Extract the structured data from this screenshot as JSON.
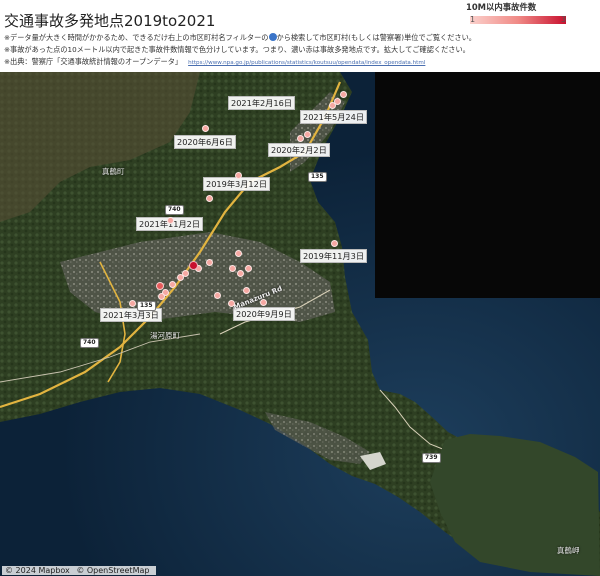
{
  "header": {
    "title": "交通事故多発地点2019to2021",
    "note1_a": "※データ量が大きく時間がかかるため、できるだけ右上の市区町村名フィルターの",
    "note1_b": "から検索して市区町村(もしくは警察署)単位でご覧ください。",
    "note2": "※事故があった点の10メートル以内で起きた事故件数情報で色分けしています。つまり、濃い赤は事故多発地点です。拡大してご確認ください。",
    "note3": "※出典：警察庁「交通事故統計情報のオープンデータ」",
    "source_url": "https://www.npa.go.jp/publications/statistics/koutsuu/opendata/index_opendata.html"
  },
  "legend": {
    "title": "10M以内事故件数",
    "min": "1",
    "max": "3",
    "color_min": "#fbd1cc",
    "color_max": "#c8102e"
  },
  "map": {
    "date_labels": [
      "2021年2月16日",
      "2021年5月24日",
      "2020年6月6日",
      "2020年2月2日",
      "2019年3月12日",
      "2021年11月2日",
      "2019年11月3日",
      "2021年3月3日",
      "2020年9月9日"
    ],
    "road_shields": [
      "135",
      "740",
      "135",
      "740",
      "739"
    ],
    "road_name": "Manazuru Rd",
    "place_labels": [
      "真鶴町",
      "湯河原町",
      "真鶴岬"
    ],
    "attribution": [
      "© 2024 Mapbox",
      "© OpenStreetMap"
    ],
    "accident_points": [
      {
        "count": 1
      },
      {
        "count": 1
      },
      {
        "count": 1
      },
      {
        "count": 1
      },
      {
        "count": 1
      },
      {
        "count": 1
      },
      {
        "count": 1
      },
      {
        "count": 1
      },
      {
        "count": 1
      },
      {
        "count": 1
      },
      {
        "count": 1
      },
      {
        "count": 1
      },
      {
        "count": 1
      },
      {
        "count": 3
      },
      {
        "count": 1
      },
      {
        "count": 1
      },
      {
        "count": 1
      },
      {
        "count": 1
      },
      {
        "count": 1
      },
      {
        "count": 1
      },
      {
        "count": 1
      },
      {
        "count": 1
      },
      {
        "count": 2
      },
      {
        "count": 1
      },
      {
        "count": 1
      },
      {
        "count": 1
      },
      {
        "count": 1
      },
      {
        "count": 1
      }
    ]
  }
}
